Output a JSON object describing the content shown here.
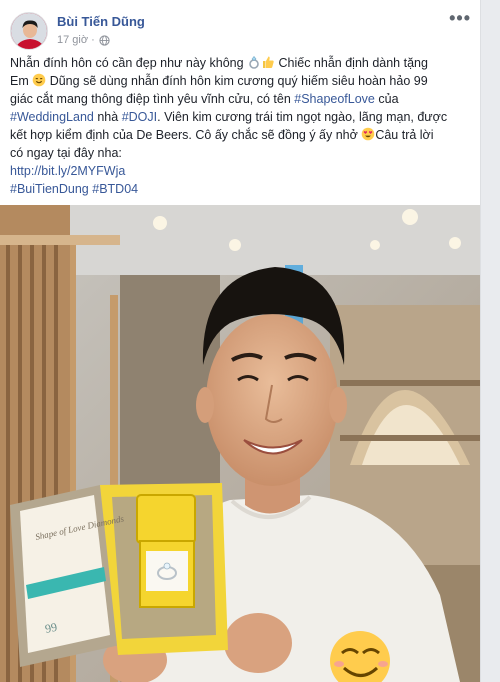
{
  "post": {
    "author": "Bùi Tiến Dũng",
    "time": "17 giờ ·",
    "privacy_icon": "globe-icon",
    "more_label": "•••",
    "text": {
      "l1a": "Nhẫn đính hôn có cần đẹp như này không ",
      "l1b": " Chiếc nhẫn định dành tặng",
      "l2a": "Em ",
      "l2b": " Dũng sẽ dùng nhẫn đính hôn kim cương quý hiếm siêu hoàn hảo 99",
      "l3a": "giác cắt mang thông điệp tình yêu vĩnh cửu, có tên ",
      "l3tag": "#ShapeofLove",
      "l3b": " của",
      "l4tag1": "#WeddingLand",
      "l4a": " nhà ",
      "l4tag2": "#DOJI",
      "l4b": ". Viên kim cương trái tim ngọt ngào, lãng mạn, được",
      "l5a": "kết hợp kiểm định của De Beers. Cô ấy chắc sẽ đồng ý ấy nhở ",
      "l5b": "Câu trả lời",
      "l6": "có ngay tại đây nha:",
      "link": "http://bit.ly/2MYFWja",
      "tag1": "#BuiTienDung",
      "tag2": "#BTD04"
    },
    "emojis": [
      "ring-emoji",
      "thumbs-up-emoji",
      "smiling-face-emoji",
      "heart-eyes-emoji",
      "smiling-face-emoji"
    ]
  },
  "photo": {
    "box_text": "Shape of Love Diamonds",
    "box_number": "99"
  }
}
